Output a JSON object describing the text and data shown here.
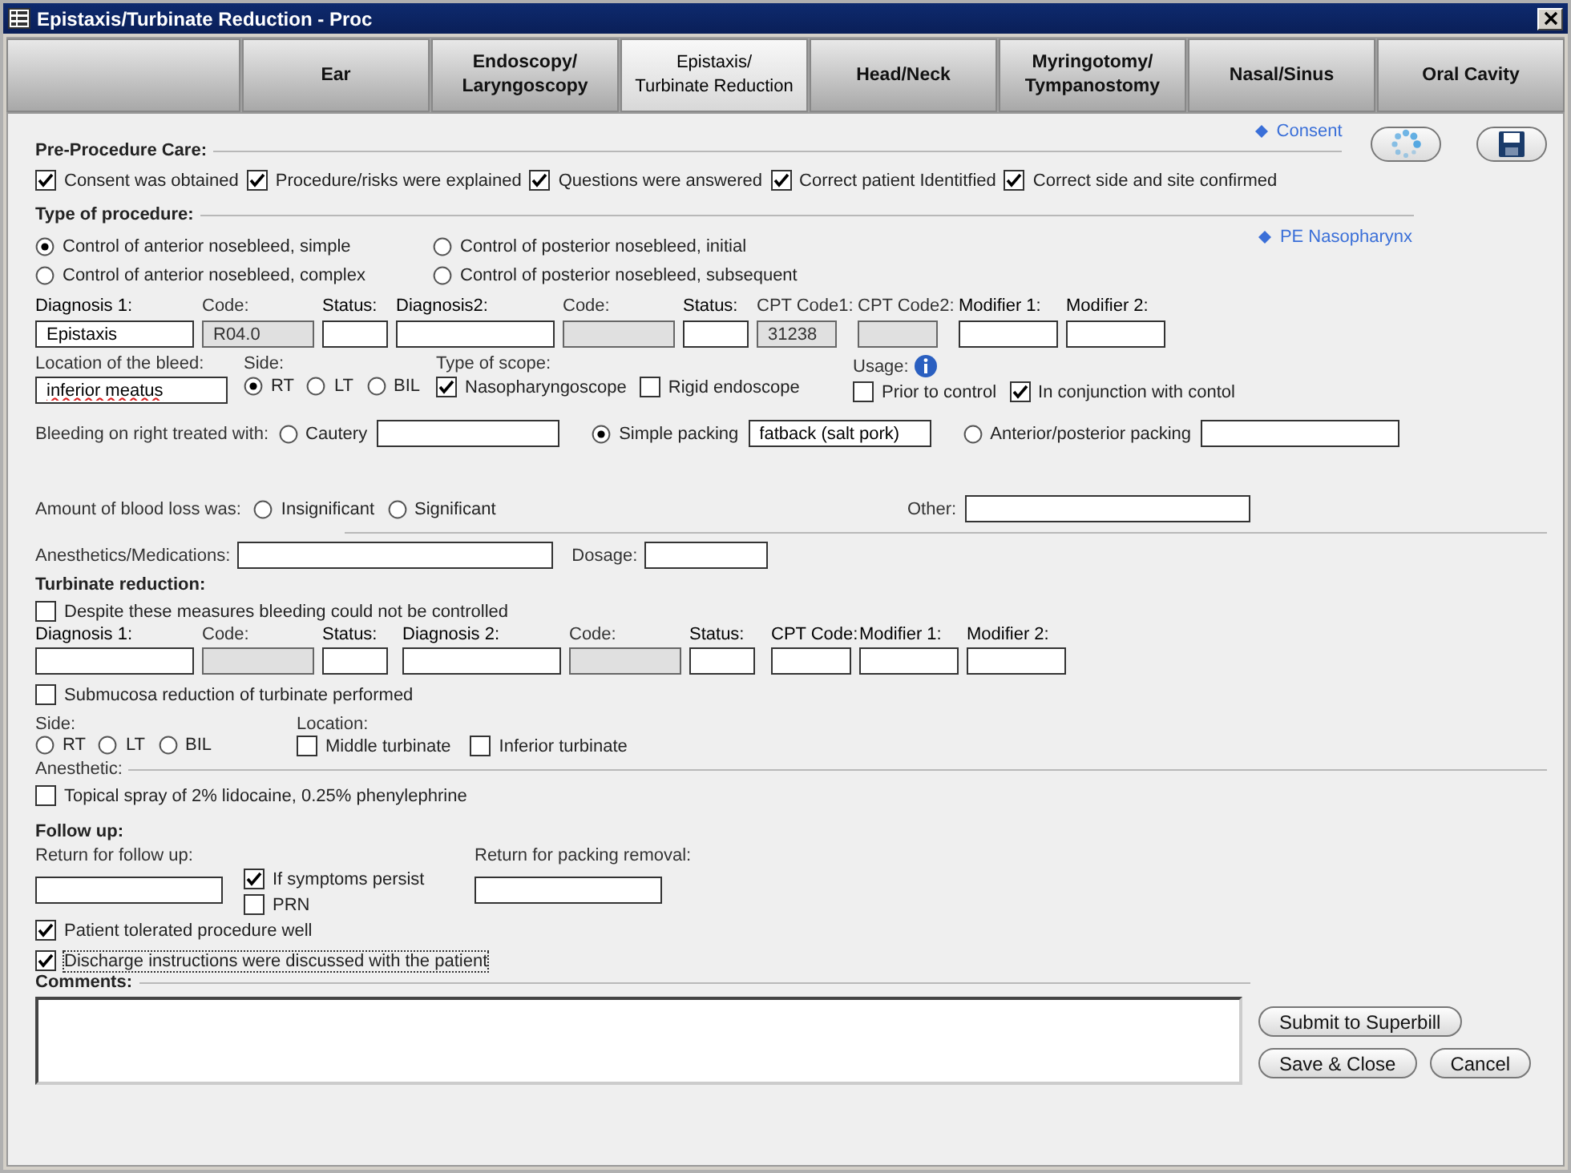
{
  "window": {
    "title": "Epistaxis/Turbinate Reduction - Proc"
  },
  "tabs": [
    {
      "label": "Ear",
      "selected": false
    },
    {
      "label": "Endoscopy/\nLaryngoscopy",
      "selected": false
    },
    {
      "label": "Epistaxis/\nTurbinate Reduction",
      "selected": true
    },
    {
      "label": "Head/Neck",
      "selected": false
    },
    {
      "label": "Myringotomy/\nTympanostomy",
      "selected": false
    },
    {
      "label": "Nasal/Sinus",
      "selected": false
    },
    {
      "label": "Oral Cavity",
      "selected": false
    }
  ],
  "pre_procedure": {
    "title": "Pre-Procedure Care:",
    "link": "Consent",
    "checks": [
      {
        "label": "Consent was obtained",
        "checked": true
      },
      {
        "label": "Procedure/risks were explained",
        "checked": true
      },
      {
        "label": "Questions were answered",
        "checked": true
      },
      {
        "label": "Correct patient Identitfied",
        "checked": true
      },
      {
        "label": "Correct side and site confirmed",
        "checked": true
      }
    ]
  },
  "procedure_type": {
    "title": "Type of procedure:",
    "link": "PE Nasopharynx",
    "options": [
      {
        "label": "Control of anterior nosebleed, simple",
        "selected": true
      },
      {
        "label": "Control of posterior nosebleed, initial",
        "selected": false
      },
      {
        "label": "Control of anterior nosebleed, complex",
        "selected": false
      },
      {
        "label": "Control of posterior nosebleed, subsequent",
        "selected": false
      }
    ]
  },
  "diagnosis_fields": [
    {
      "label": "Diagnosis 1:",
      "value": "Epistaxis",
      "disabled": false
    },
    {
      "label": "Code:",
      "value": "R04.0",
      "disabled": true
    },
    {
      "label": "Status:",
      "disabled": false
    },
    {
      "label": "Diagnosis2:",
      "disabled": false
    },
    {
      "label": "Code:",
      "disabled": true
    },
    {
      "label": "Status:",
      "disabled": false
    },
    {
      "label": "CPT Code1:",
      "value": "31238",
      "disabled": true
    },
    {
      "label": "CPT Code2:",
      "disabled": true
    },
    {
      "label": "Modifier 1:",
      "disabled": false
    },
    {
      "label": "Modifier 2:",
      "disabled": false
    }
  ],
  "location": {
    "label": "Location of the bleed:",
    "value": "inferior meatus"
  },
  "side": {
    "label": "Side:",
    "options": [
      {
        "label": "RT",
        "selected": true
      },
      {
        "label": "LT",
        "selected": false
      },
      {
        "label": "BIL",
        "selected": false
      }
    ]
  },
  "scope": {
    "label": "Type of scope:",
    "checks": [
      {
        "label": "Nasopharyngoscope",
        "checked": true
      },
      {
        "label": "Rigid endoscope",
        "checked": false
      }
    ]
  },
  "usage": {
    "label": "Usage:",
    "checks": [
      {
        "label": "Prior to control",
        "checked": false
      },
      {
        "label": "In conjunction with contol",
        "checked": true
      }
    ]
  },
  "bleeding_treatment": {
    "label": "Bleeding on right treated with:",
    "options": [
      {
        "label": "Cautery",
        "selected": false
      },
      {
        "label": "Simple packing",
        "selected": true,
        "value": "fatback (salt pork)"
      },
      {
        "label": "Anterior/posterior packing",
        "selected": false
      }
    ]
  },
  "blood_loss": {
    "label": "Amount of blood loss was:",
    "options": [
      {
        "label": "Insignificant",
        "selected": false
      },
      {
        "label": "Significant",
        "selected": false
      }
    ],
    "other_label": "Other:"
  },
  "anesthetics": {
    "label": "Anesthetics/Medications:",
    "dosage_label": "Dosage:"
  },
  "turbinate": {
    "title": "Turbinate reduction:",
    "uncontrolled": {
      "label": "Despite these measures bleeding could not be controlled",
      "checked": false
    },
    "fields": [
      {
        "label": "Diagnosis 1:",
        "disabled": false
      },
      {
        "label": "Code:",
        "disabled": true
      },
      {
        "label": "Status:",
        "disabled": false
      },
      {
        "label": "Diagnosis 2:",
        "disabled": false
      },
      {
        "label": "Code:",
        "disabled": true
      },
      {
        "label": "Status:",
        "disabled": false
      },
      {
        "label": "CPT Code:",
        "disabled": false
      },
      {
        "label": "Modifier 1:",
        "disabled": false
      },
      {
        "label": "Modifier 2:",
        "disabled": false
      }
    ],
    "submucosa": {
      "label": "Submucosa reduction of turbinate performed",
      "checked": false
    },
    "side": {
      "label": "Side:",
      "options": [
        {
          "label": "RT",
          "selected": false
        },
        {
          "label": "LT",
          "selected": false
        },
        {
          "label": "BIL",
          "selected": false
        }
      ]
    },
    "location": {
      "label": "Location:",
      "checks": [
        {
          "label": "Middle turbinate",
          "checked": false
        },
        {
          "label": "Inferior turbinate",
          "checked": false
        }
      ]
    }
  },
  "anesthetic": {
    "title": "Anesthetic:",
    "checks": [
      {
        "label": "Topical spray of 2% lidocaine, 0.25% phenylephrine",
        "checked": false
      }
    ]
  },
  "follow_up": {
    "title": "Follow up:",
    "return_label": "Return for follow up:",
    "checks": [
      {
        "label": "If symptoms persist",
        "checked": true
      },
      {
        "label": "PRN",
        "checked": false
      }
    ],
    "packing_label": "Return for packing removal:",
    "final_checks": [
      {
        "label": "Patient tolerated procedure well",
        "checked": true,
        "focused": false
      },
      {
        "label": "Discharge instructions were discussed with the patient",
        "checked": true,
        "focused": true
      }
    ]
  },
  "comments": {
    "label": "Comments:"
  },
  "buttons": [
    "Submit to Superbill",
    "Save & Close",
    "Cancel"
  ]
}
